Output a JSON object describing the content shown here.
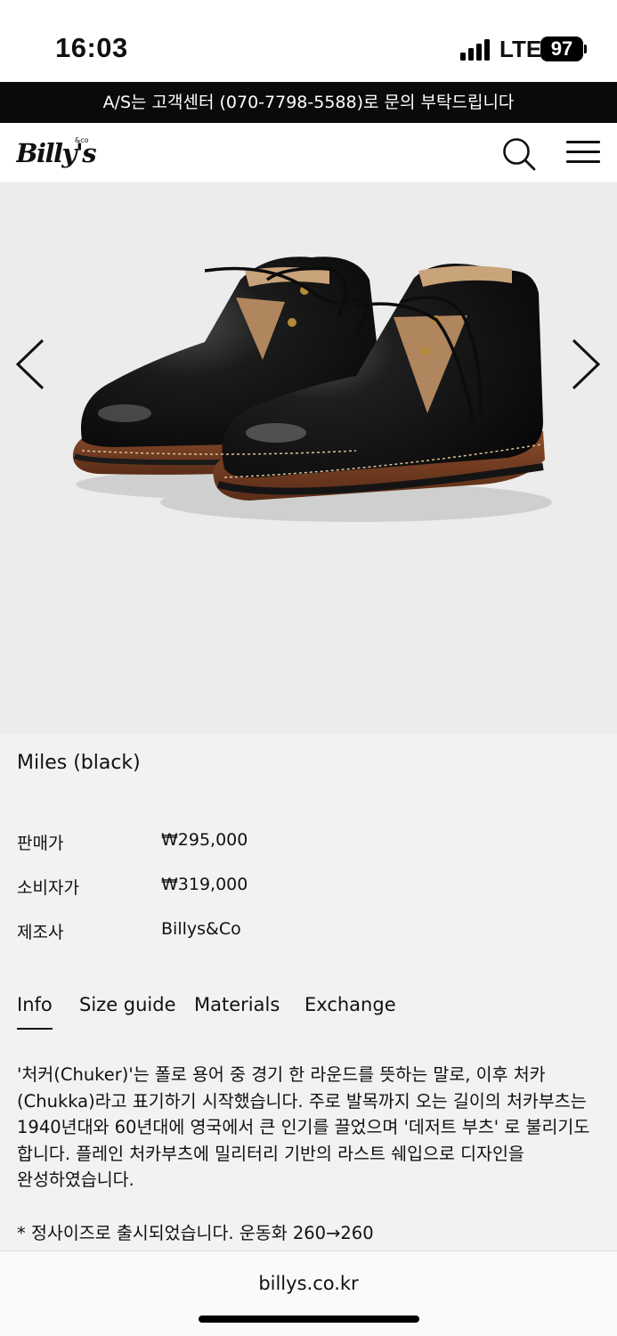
{
  "status": {
    "time": "16:03",
    "network": "LTE",
    "battery": "97"
  },
  "announcement": {
    "text": "A/S는 고객센터 (070-7798-5588)로 문의 부탁드립니다"
  },
  "header": {
    "logo_text": "Billy's",
    "logo_sup": "&co",
    "search_icon": "search-icon",
    "menu_icon": "menu-icon"
  },
  "gallery": {
    "prev_icon": "chevron-left-icon",
    "next_icon": "chevron-right-icon",
    "image_subject": "black leather chukka boots"
  },
  "product": {
    "name": "Miles (black)",
    "rows": [
      {
        "label": "판매가",
        "value": "₩295,000"
      },
      {
        "label": "소비자가",
        "value": "₩319,000"
      },
      {
        "label": "제조사",
        "value": "Billys&Co"
      }
    ]
  },
  "tabs": [
    {
      "label": "Info",
      "active": true
    },
    {
      "label": "Size guide",
      "active": false
    },
    {
      "label": "Materials",
      "active": false
    },
    {
      "label": "Exchange",
      "active": false
    }
  ],
  "description": "'처커(Chuker)'는 폴로 용어 중 경기 한 라운드를 뜻하는 말로, 이후 처카(Chukka)라고 표기하기 시작했습니다. 주로 발목까지 오는 길이의 처카부츠는 1940년대와 60년대에 영국에서 큰 인기를 끌었으며 '데저트 부츠' 로 불리기도 합니다. 플레인 처카부츠에 밀리터리 기반의 라스트 쉐입으로 디자인을 완성하였습니다.",
  "note": "* 정사이즈로 출시되었습니다. 운동화 260→260",
  "browser": {
    "url": "billys.co.kr"
  }
}
